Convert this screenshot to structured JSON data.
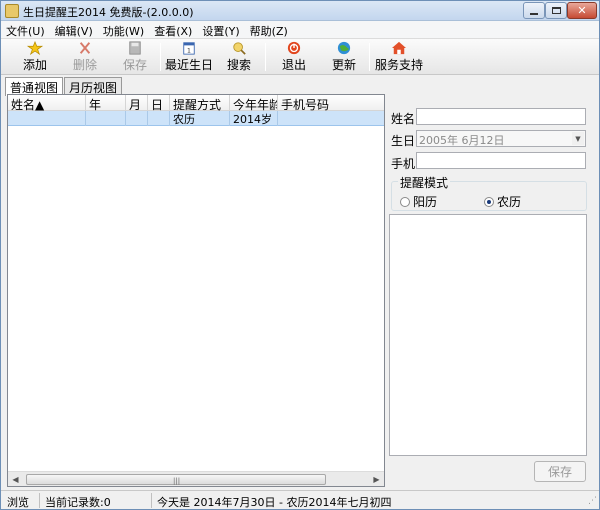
{
  "window": {
    "title": "生日提醒王2014 免费版-(2.0.0.0)"
  },
  "menu": [
    "文件(U)",
    "编辑(V)",
    "功能(W)",
    "查看(X)",
    "设置(Y)",
    "帮助(Z)"
  ],
  "toolbar": {
    "add": "添加",
    "delete": "删除",
    "save": "保存",
    "recent": "最近生日",
    "search": "搜索",
    "exit": "退出",
    "update": "更新",
    "service": "服务支持"
  },
  "tabs": [
    "普通视图",
    "月历视图"
  ],
  "list": {
    "columns": [
      "姓名▲",
      "年",
      "月",
      "日",
      "提醒方式",
      "今年年龄",
      "手机号码"
    ],
    "rows": [
      {
        "name": "",
        "year": "",
        "month": "",
        "day": "",
        "mode": "农历",
        "age": "2014岁",
        "phone": ""
      }
    ]
  },
  "detail": {
    "name_label": "姓名",
    "name_value": "",
    "birthday_label": "生日",
    "birthday_value": "2005年  6月12日",
    "phone_label": "手机",
    "phone_value": "",
    "mode_title": "提醒模式",
    "mode_options": [
      "阳历",
      "农历"
    ],
    "mode_selected": "农历",
    "save_label": "保存"
  },
  "status": {
    "mode": "浏览",
    "count": "当前记录数:0",
    "today": "今天是 2014年7月30日 - 农历2014年七月初四"
  },
  "colors": {
    "selection": "#cde3f9",
    "title_gradient": "#c3d6ee"
  }
}
